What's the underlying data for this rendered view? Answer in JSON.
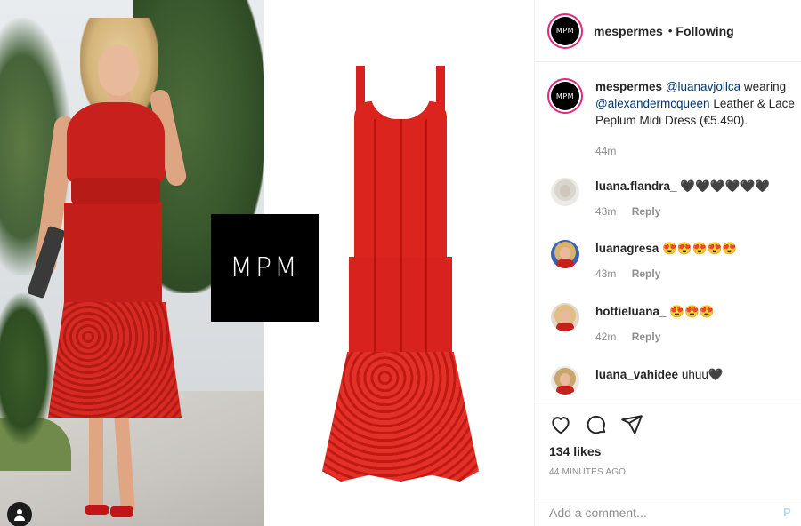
{
  "post": {
    "logo_text": "MPM",
    "avatar_text": "MPM"
  },
  "header": {
    "username": "mespermes",
    "separator": "•",
    "follow_state": "Following"
  },
  "caption": {
    "username": "mespermes",
    "mention1": "@luanavjollca",
    "text1": "wearing",
    "mention2": "@alexandermcqueen",
    "text2": "Leather & Lace Peplum Midi Dress (€5.490).",
    "time": "44m"
  },
  "comments": [
    {
      "username": "luana.flandra_",
      "text": "🖤🖤🖤🖤🖤🖤",
      "time": "43m",
      "reply": "Reply"
    },
    {
      "username": "luanagresa",
      "text": "😍😍😍😍😍",
      "time": "43m",
      "reply": "Reply"
    },
    {
      "username": "hottieluana_",
      "text": "😍😍😍",
      "time": "42m",
      "reply": "Reply"
    },
    {
      "username": "luana_vahidee",
      "text": "uhuu🖤",
      "time": "",
      "reply": ""
    }
  ],
  "actions": {
    "likes": "134 likes",
    "time_ago": "44 MINUTES AGO"
  },
  "composer": {
    "placeholder": "Add a comment...",
    "post_label": "P"
  },
  "colors": {
    "accent_link": "#00376b",
    "muted": "#8e8e8e",
    "story_ring": "#dd2a7b"
  }
}
